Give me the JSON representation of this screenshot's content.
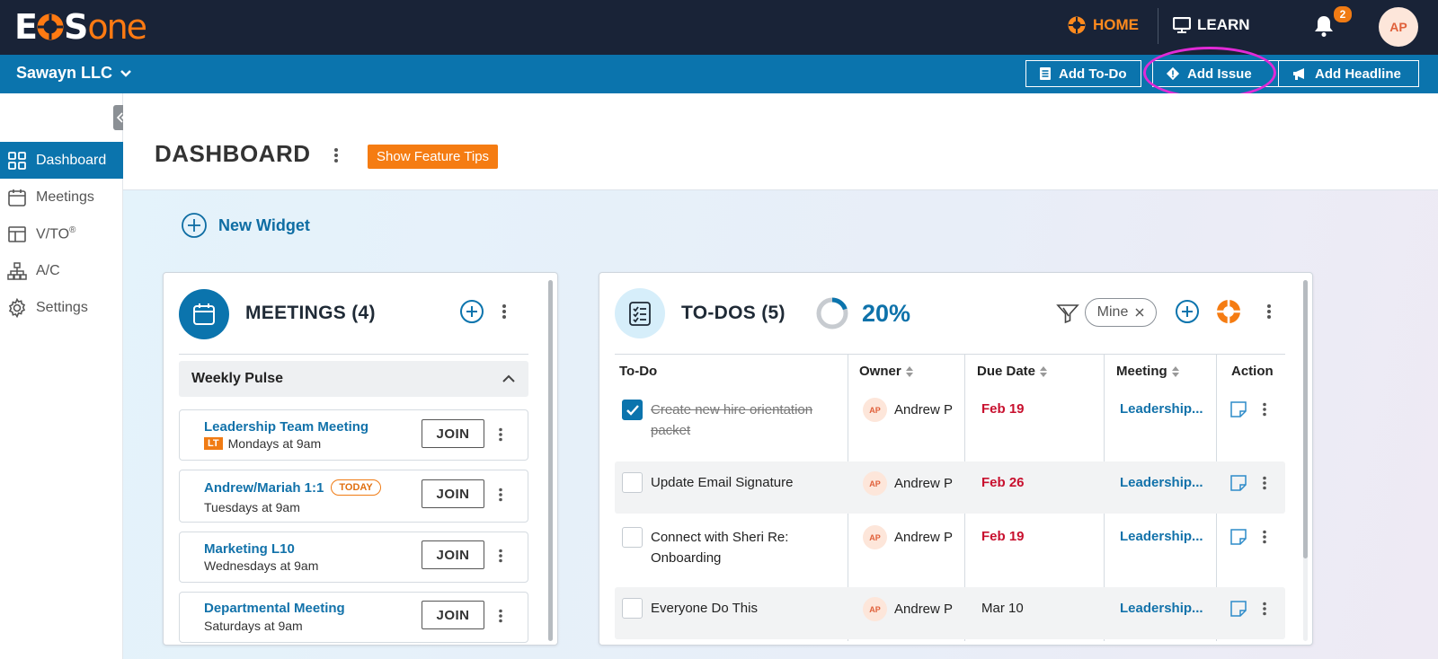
{
  "brand": {
    "logo": {
      "e": "E",
      "o": "O",
      "s": "S",
      "one": "one"
    }
  },
  "topnav": {
    "home": "HOME",
    "learn": "LEARN",
    "notifications": "2",
    "avatar": "AP"
  },
  "orgbar": {
    "org": "Sawayn LLC",
    "add_todo": "Add To-Do",
    "add_issue": "Add Issue",
    "add_headline": "Add Headline"
  },
  "sidebar": {
    "items": [
      {
        "label": "Dashboard",
        "icon": "dashboard-grid-icon"
      },
      {
        "label": "Meetings",
        "icon": "calendar-icon"
      },
      {
        "label": "V/TO",
        "sup": "®",
        "icon": "layout-icon"
      },
      {
        "label": "A/C",
        "icon": "org-chart-icon"
      },
      {
        "label": "Settings",
        "icon": "gear-icon"
      }
    ]
  },
  "page": {
    "title": "DASHBOARD",
    "feature_tips": "Show Feature Tips",
    "new_widget": "New Widget"
  },
  "meetings": {
    "title": "MEETINGS (4)",
    "group": "Weekly Pulse",
    "join_label": "JOIN",
    "items": [
      {
        "name": "Leadership Team Meeting",
        "tag": "LT",
        "schedule": "Mondays at 9am"
      },
      {
        "name": "Andrew/Mariah 1:1",
        "badge": "TODAY",
        "schedule": "Tuesdays at 9am"
      },
      {
        "name": "Marketing L10",
        "schedule": "Wednesdays at 9am"
      },
      {
        "name": "Departmental Meeting",
        "schedule": "Saturdays at 9am"
      }
    ]
  },
  "todos": {
    "title": "TO-DOS (5)",
    "percent": "20%",
    "progress_fraction": 0.2,
    "filter_chip": "Mine",
    "columns": [
      "To-Do",
      "Owner",
      "Due Date",
      "Meeting",
      "Action"
    ],
    "rows": [
      {
        "text": "Create new hire orientation packet",
        "done": true,
        "owner": "Andrew P",
        "owner_initials": "AP",
        "due": "Feb 19",
        "overdue": true,
        "meeting": "Leadership..."
      },
      {
        "text": "Update Email Signature",
        "done": false,
        "owner": "Andrew P",
        "owner_initials": "AP",
        "due": "Feb 26",
        "overdue": true,
        "meeting": "Leadership..."
      },
      {
        "text": "Connect with Sheri Re: Onboarding",
        "done": false,
        "owner": "Andrew P",
        "owner_initials": "AP",
        "due": "Feb 19",
        "overdue": true,
        "meeting": "Leadership..."
      },
      {
        "text": "Everyone Do This",
        "done": false,
        "owner": "Andrew P",
        "owner_initials": "AP",
        "due": "Mar 10",
        "overdue": false,
        "meeting": "Leadership..."
      }
    ]
  },
  "colors": {
    "navy": "#192337",
    "blue": "#0b74ad",
    "orange": "#f57c12",
    "overdue_red": "#c8102e",
    "highlight_magenta": "#e12ad6"
  }
}
